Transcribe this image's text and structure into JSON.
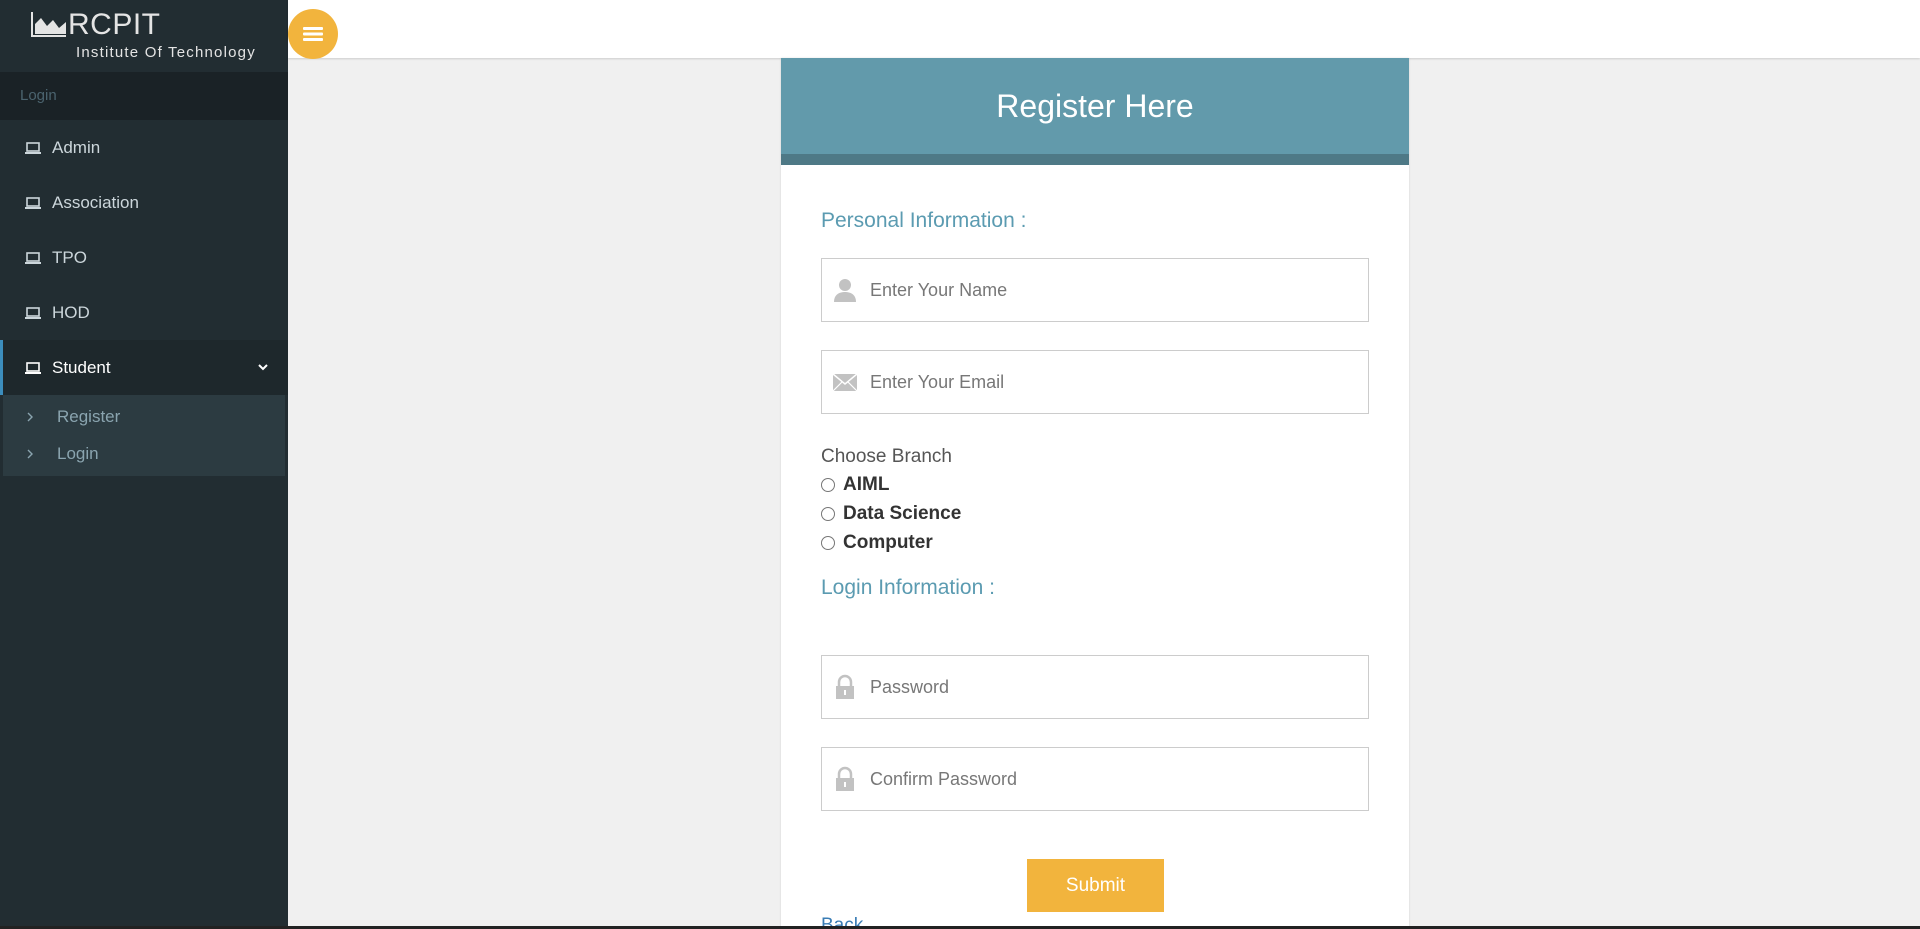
{
  "brand": {
    "title": "RCPIT",
    "subtitle": "Institute Of Technology"
  },
  "sidebar": {
    "header": "Login",
    "items": [
      {
        "label": "Admin",
        "icon": "laptop-icon"
      },
      {
        "label": "Association",
        "icon": "laptop-icon"
      },
      {
        "label": "TPO",
        "icon": "laptop-icon"
      },
      {
        "label": "HOD",
        "icon": "laptop-icon"
      },
      {
        "label": "Student",
        "icon": "laptop-icon",
        "expanded": true
      }
    ],
    "subitems": [
      {
        "label": "Register",
        "icon": "chevron-right-icon"
      },
      {
        "label": "Login",
        "icon": "chevron-right-icon"
      }
    ]
  },
  "topbar": {
    "menu_icon": "hamburger-icon"
  },
  "form": {
    "heading": "Register Here",
    "personal_title": "Personal Information :",
    "name_placeholder": "Enter Your Name",
    "email_placeholder": "Enter Your Email",
    "branch_label": "Choose Branch",
    "branches": [
      "AIML",
      "Data Science",
      "Computer"
    ],
    "login_title": "Login Information :",
    "password_placeholder": "Password",
    "confirm_placeholder": "Confirm Password",
    "submit_label": "Submit",
    "back_label": "Back"
  },
  "colors": {
    "sidebar_bg": "#222d32",
    "accent_yellow": "#f2b43d",
    "header_teal": "#629aab",
    "section_blue": "#5b9bb1",
    "link_blue": "#3a7db5"
  }
}
